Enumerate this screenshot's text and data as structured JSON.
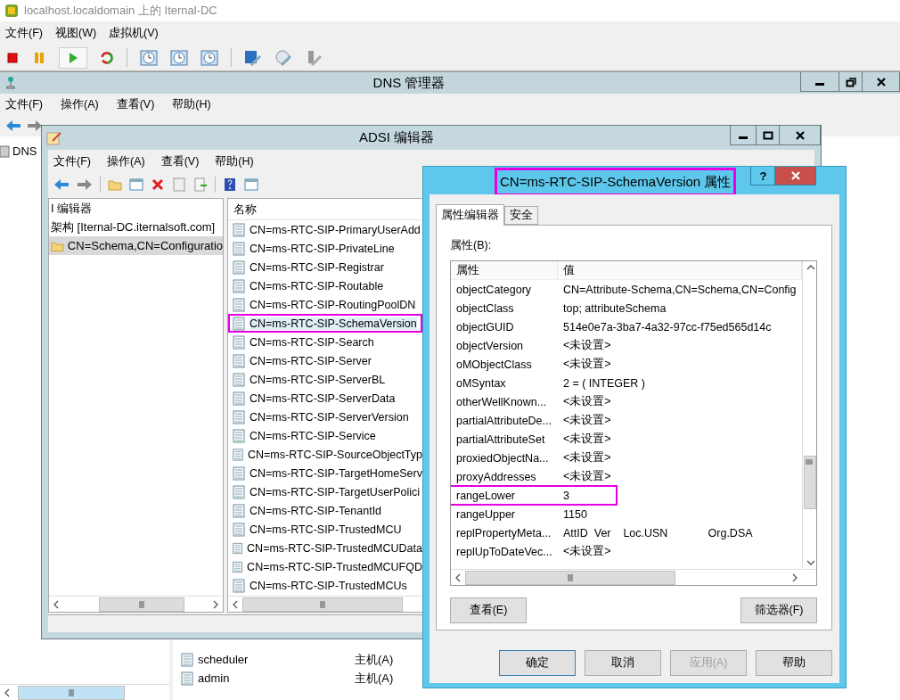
{
  "vm_window": {
    "title": "localhost.localdomain 上的 Iternal-DC",
    "menu": [
      "文件(F)",
      "视图(W)",
      "虚拟机(V)"
    ]
  },
  "dns_window": {
    "title": "DNS 管理器",
    "menu": [
      "文件(F)",
      "操作(A)",
      "查看(V)",
      "帮助(H)"
    ],
    "tree": [
      {
        "label": "DNS"
      }
    ],
    "rows": [
      {
        "name": "scheduler",
        "type": "主机(A)"
      },
      {
        "name": "admin",
        "type": "主机(A)"
      }
    ]
  },
  "adsi_window": {
    "title": "ADSI 编辑器",
    "menu": [
      "文件(F)",
      "操作(A)",
      "查看(V)",
      "帮助(H)"
    ],
    "tree": [
      {
        "label": "I 编辑器",
        "kind": "root",
        "selected": false
      },
      {
        "label": "架构 [Iternal-DC.iternalsoft.com]",
        "kind": "server",
        "selected": false
      },
      {
        "label": "CN=Schema,CN=Configuratio",
        "kind": "folder",
        "selected": true
      }
    ],
    "list_header": "名称",
    "items": [
      {
        "name": "CN=ms-RTC-SIP-PrimaryUserAdd",
        "selected": false,
        "highlighted": false
      },
      {
        "name": "CN=ms-RTC-SIP-PrivateLine",
        "selected": false,
        "highlighted": false
      },
      {
        "name": "CN=ms-RTC-SIP-Registrar",
        "selected": false,
        "highlighted": false
      },
      {
        "name": "CN=ms-RTC-SIP-Routable",
        "selected": false,
        "highlighted": false
      },
      {
        "name": "CN=ms-RTC-SIP-RoutingPoolDN",
        "selected": false,
        "highlighted": false
      },
      {
        "name": "CN=ms-RTC-SIP-SchemaVersion",
        "selected": true,
        "highlighted": true
      },
      {
        "name": "CN=ms-RTC-SIP-Search",
        "selected": false,
        "highlighted": false
      },
      {
        "name": "CN=ms-RTC-SIP-Server",
        "selected": false,
        "highlighted": false
      },
      {
        "name": "CN=ms-RTC-SIP-ServerBL",
        "selected": false,
        "highlighted": false
      },
      {
        "name": "CN=ms-RTC-SIP-ServerData",
        "selected": false,
        "highlighted": false
      },
      {
        "name": "CN=ms-RTC-SIP-ServerVersion",
        "selected": false,
        "highlighted": false
      },
      {
        "name": "CN=ms-RTC-SIP-Service",
        "selected": false,
        "highlighted": false
      },
      {
        "name": "CN=ms-RTC-SIP-SourceObjectTyp",
        "selected": false,
        "highlighted": false
      },
      {
        "name": "CN=ms-RTC-SIP-TargetHomeServ",
        "selected": false,
        "highlighted": false
      },
      {
        "name": "CN=ms-RTC-SIP-TargetUserPolici",
        "selected": false,
        "highlighted": false
      },
      {
        "name": "CN=ms-RTC-SIP-TenantId",
        "selected": false,
        "highlighted": false
      },
      {
        "name": "CN=ms-RTC-SIP-TrustedMCU",
        "selected": false,
        "highlighted": false
      },
      {
        "name": "CN=ms-RTC-SIP-TrustedMCUData",
        "selected": false,
        "highlighted": false
      },
      {
        "name": "CN=ms-RTC-SIP-TrustedMCUFQD",
        "selected": false,
        "highlighted": false
      },
      {
        "name": "CN=ms-RTC-SIP-TrustedMCUs",
        "selected": false,
        "highlighted": false
      }
    ]
  },
  "properties_dialog": {
    "title": "CN=ms-RTC-SIP-SchemaVersion 属性",
    "title_highlighted": true,
    "help": "?",
    "tabs": [
      {
        "label": "属性编辑器",
        "selected": true
      },
      {
        "label": "安全",
        "selected": false
      }
    ],
    "list_label": "属性(B):",
    "columns": [
      "属性",
      "值"
    ],
    "rows": [
      {
        "attribute": "objectCategory",
        "value": "CN=Attribute-Schema,CN=Schema,CN=Config",
        "highlighted": false
      },
      {
        "attribute": "objectClass",
        "value": "top; attributeSchema",
        "highlighted": false
      },
      {
        "attribute": "objectGUID",
        "value": "514e0e7a-3ba7-4a32-97cc-f75ed565d14c",
        "highlighted": false
      },
      {
        "attribute": "objectVersion",
        "value": "<未设置>",
        "highlighted": false
      },
      {
        "attribute": "oMObjectClass",
        "value": "<未设置>",
        "highlighted": false
      },
      {
        "attribute": "oMSyntax",
        "value": "2 = ( INTEGER )",
        "highlighted": false
      },
      {
        "attribute": "otherWellKnown...",
        "value": "<未设置>",
        "highlighted": false
      },
      {
        "attribute": "partialAttributeDe...",
        "value": "<未设置>",
        "highlighted": false
      },
      {
        "attribute": "partialAttributeSet",
        "value": "<未设置>",
        "highlighted": false
      },
      {
        "attribute": "proxiedObjectNa...",
        "value": "<未设置>",
        "highlighted": false
      },
      {
        "attribute": "proxyAddresses",
        "value": "<未设置>",
        "highlighted": false
      },
      {
        "attribute": "rangeLower",
        "value": "3",
        "highlighted": true
      },
      {
        "attribute": "rangeUpper",
        "value": "1150",
        "highlighted": false
      },
      {
        "attribute": "replPropertyMeta...",
        "value": "AttID  Ver    Loc.USN             Org.DSA",
        "highlighted": false
      },
      {
        "attribute": "replUpToDateVec...",
        "value": "<未设置>",
        "highlighted": false
      }
    ],
    "buttons": [
      {
        "label": "查看(E)"
      },
      {
        "label": "筛选器(F)"
      }
    ],
    "footer_buttons": [
      {
        "label": "确定",
        "default": true,
        "disabled": false
      },
      {
        "label": "取消",
        "default": false,
        "disabled": false
      },
      {
        "label": "应用(A)",
        "default": false,
        "disabled": true
      },
      {
        "label": "帮助",
        "default": false,
        "disabled": false
      }
    ]
  }
}
